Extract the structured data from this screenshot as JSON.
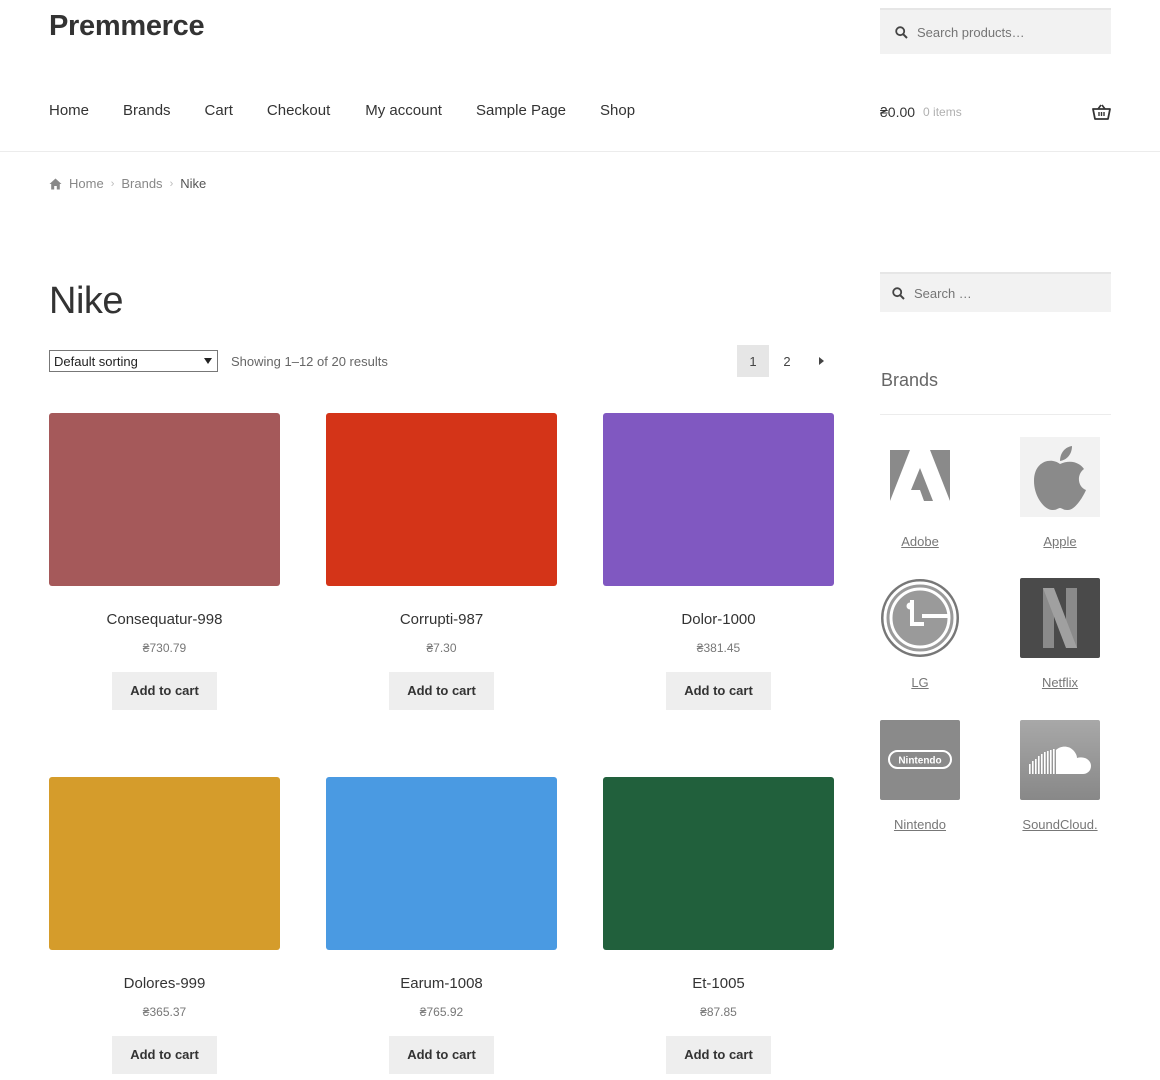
{
  "header": {
    "site_title": "Premmerce",
    "search_placeholder": "Search products…",
    "nav": [
      "Home",
      "Brands",
      "Cart",
      "Checkout",
      "My account",
      "Sample Page",
      "Shop"
    ],
    "cart_amount": "₴0.00",
    "cart_count": "0 items"
  },
  "breadcrumb": {
    "items": [
      "Home",
      "Brands"
    ],
    "current": "Nike"
  },
  "main": {
    "title": "Nike",
    "sorting": "Default sorting",
    "result_count": "Showing 1–12 of 20 results",
    "pages": [
      "1",
      "2"
    ],
    "products": [
      {
        "name": "Consequatur-998",
        "price": "₴730.79",
        "color": "#a5595a",
        "button": "Add to cart"
      },
      {
        "name": "Corrupti-987",
        "price": "₴7.30",
        "color": "#d43418",
        "button": "Add to cart"
      },
      {
        "name": "Dolor-1000",
        "price": "₴381.45",
        "color": "#8058c1",
        "button": "Add to cart"
      },
      {
        "name": "Dolores-999",
        "price": "₴365.37",
        "color": "#d59c2b",
        "button": "Add to cart"
      },
      {
        "name": "Earum-1008",
        "price": "₴765.92",
        "color": "#4a9ae2",
        "button": "Add to cart"
      },
      {
        "name": "Et-1005",
        "price": "₴87.85",
        "color": "#21603c",
        "button": "Add to cart"
      }
    ]
  },
  "sidebar": {
    "search_placeholder": "Search …",
    "widget_title": "Brands",
    "brands": [
      {
        "name": "Adobe",
        "icon": "adobe-logo"
      },
      {
        "name": "Apple",
        "icon": "apple-logo"
      },
      {
        "name": "LG",
        "icon": "lg-logo"
      },
      {
        "name": "Netflix",
        "icon": "netflix-logo"
      },
      {
        "name": "Nintendo",
        "icon": "nintendo-logo",
        "logo_text": "Nintendo"
      },
      {
        "name": "SoundCloud.",
        "icon": "soundcloud-logo"
      }
    ]
  }
}
